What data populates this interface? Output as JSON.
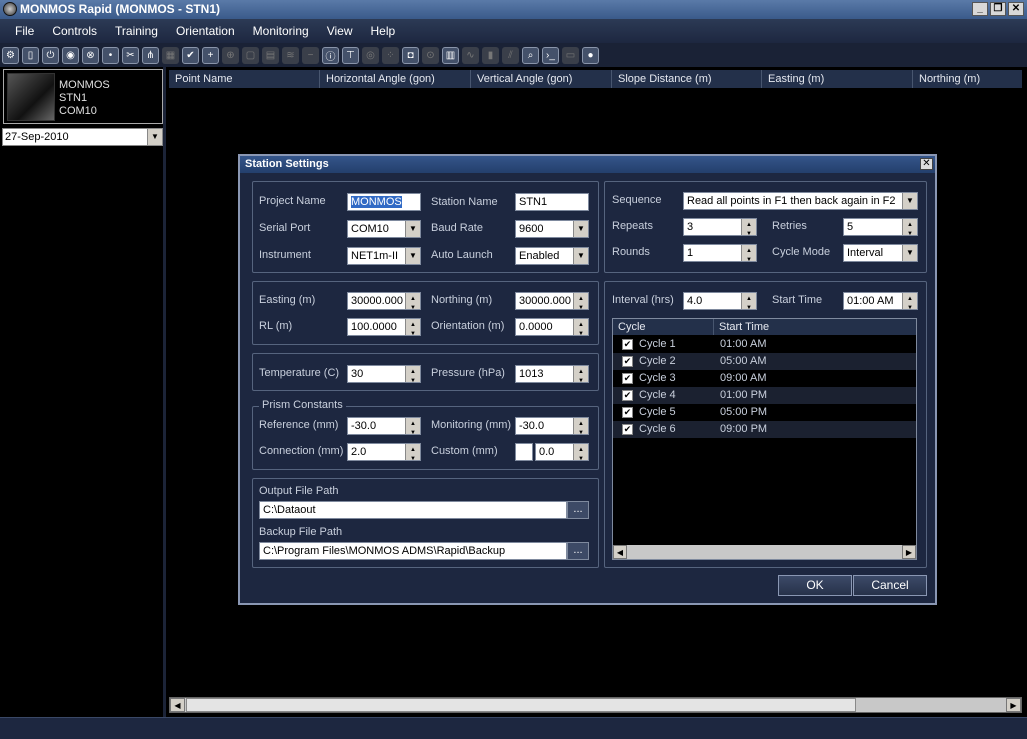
{
  "window": {
    "title": "MONMOS Rapid (MONMOS - STN1)",
    "min": "_",
    "max": "❐",
    "close": "✕"
  },
  "menu": [
    "File",
    "Controls",
    "Training",
    "Orientation",
    "Monitoring",
    "View",
    "Help"
  ],
  "station": {
    "line1": "MONMOS",
    "line2": "STN1",
    "line3": "COM10"
  },
  "date": "27-Sep-2010",
  "grid_columns": [
    "Point Name",
    "Horizontal Angle (gon)",
    "Vertical Angle (gon)",
    "Slope Distance (m)",
    "Easting (m)",
    "Northing (m)"
  ],
  "dialog": {
    "title": "Station Settings",
    "labels": {
      "project_name": "Project Name",
      "station_name": "Station Name",
      "serial_port": "Serial Port",
      "baud_rate": "Baud Rate",
      "instrument": "Instrument",
      "auto_launch": "Auto Launch",
      "easting": "Easting (m)",
      "northing": "Northing (m)",
      "rl": "RL (m)",
      "orientation": "Orientation (m)",
      "temperature": "Temperature (C)",
      "pressure": "Pressure (hPa)",
      "prism_constants": "Prism Constants",
      "reference": "Reference (mm)",
      "monitoring": "Monitoring (mm)",
      "connection": "Connection (mm)",
      "custom": "Custom (mm)",
      "output_path": "Output File Path",
      "backup_path": "Backup File Path",
      "sequence": "Sequence",
      "repeats": "Repeats",
      "retries": "Retries",
      "rounds": "Rounds",
      "cycle_mode": "Cycle Mode",
      "interval": "Interval (hrs)",
      "start_time": "Start Time"
    },
    "values": {
      "project_name": "MONMOS",
      "station_name": "STN1",
      "serial_port": "COM10",
      "baud_rate": "9600",
      "instrument": "NET1m-II",
      "auto_launch": "Enabled",
      "easting": "30000.000",
      "northing": "30000.000",
      "rl": "100.0000",
      "orientation": "0.0000",
      "temperature": "30",
      "pressure": "1013",
      "reference": "-30.0",
      "monitoring": "-30.0",
      "connection": "2.0",
      "custom": "0.0",
      "output_path": "C:\\Dataout",
      "backup_path": "C:\\Program Files\\MONMOS ADMS\\Rapid\\Backup",
      "sequence": "Read all points in F1 then back again in F2",
      "repeats": "3",
      "retries": "5",
      "rounds": "1",
      "cycle_mode": "Interval",
      "interval": "4.0",
      "start_time": "01:00 AM"
    },
    "browse": "...",
    "cycle_headers": [
      "Cycle",
      "Start Time"
    ],
    "cycles": [
      {
        "name": "Cycle 1",
        "time": "01:00 AM"
      },
      {
        "name": "Cycle 2",
        "time": "05:00 AM"
      },
      {
        "name": "Cycle 3",
        "time": "09:00 AM"
      },
      {
        "name": "Cycle 4",
        "time": "01:00 PM"
      },
      {
        "name": "Cycle 5",
        "time": "05:00 PM"
      },
      {
        "name": "Cycle 6",
        "time": "09:00 PM"
      }
    ],
    "ok": "OK",
    "cancel": "Cancel"
  }
}
